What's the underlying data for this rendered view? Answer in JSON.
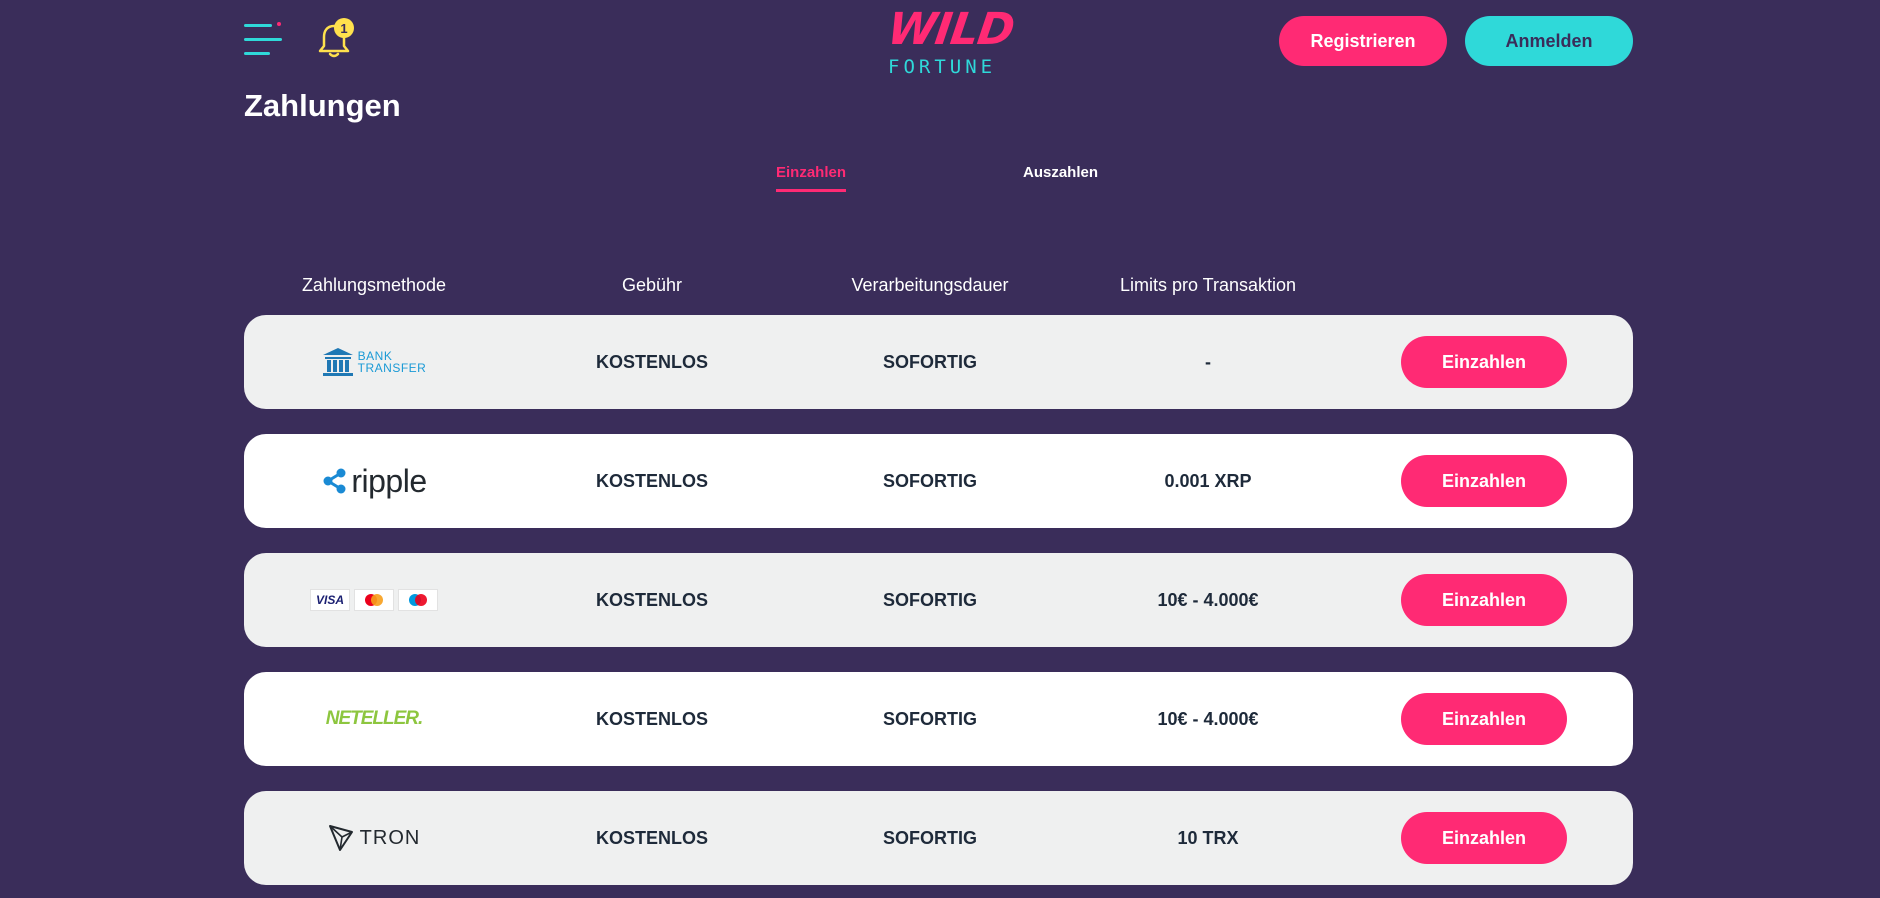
{
  "header": {
    "notification_count": "1",
    "logo": {
      "top": "WILD",
      "bottom": "FORTUNE"
    },
    "register_label": "Registrieren",
    "login_label": "Anmelden"
  },
  "page": {
    "title": "Zahlungen",
    "tabs": [
      {
        "label": "Einzahlen",
        "active": true
      },
      {
        "label": "Auszahlen",
        "active": false
      }
    ]
  },
  "table": {
    "columns": [
      "Zahlungsmethode",
      "Gebühr",
      "Verarbeitungsdauer",
      "Limits pro Transaktion"
    ],
    "rows": [
      {
        "method": "bank-transfer",
        "logo_text_1": "BANK",
        "logo_text_2": "TRANSFER",
        "fee": "KOSTENLOS",
        "duration": "SOFORTIG",
        "limits": "-",
        "button": "Einzahlen"
      },
      {
        "method": "ripple",
        "logo_text": "ripple",
        "fee": "KOSTENLOS",
        "duration": "SOFORTIG",
        "limits": "0.001 XRP",
        "button": "Einzahlen"
      },
      {
        "method": "cards",
        "logo_text": "VISA",
        "fee": "KOSTENLOS",
        "duration": "SOFORTIG",
        "limits": "10€ - 4.000€",
        "button": "Einzahlen"
      },
      {
        "method": "neteller",
        "logo_text": "NETELLER.",
        "fee": "KOSTENLOS",
        "duration": "SOFORTIG",
        "limits": "10€ - 4.000€",
        "button": "Einzahlen"
      },
      {
        "method": "tron",
        "logo_text": "TRON",
        "fee": "KOSTENLOS",
        "duration": "SOFORTIG",
        "limits": "10 TRX",
        "button": "Einzahlen"
      }
    ]
  },
  "colors": {
    "background": "#3a2d5a",
    "accent_pink": "#ff2a74",
    "accent_cyan": "#2fd9d9",
    "row_alt": "#eff0f0",
    "row_white": "#ffffff"
  }
}
